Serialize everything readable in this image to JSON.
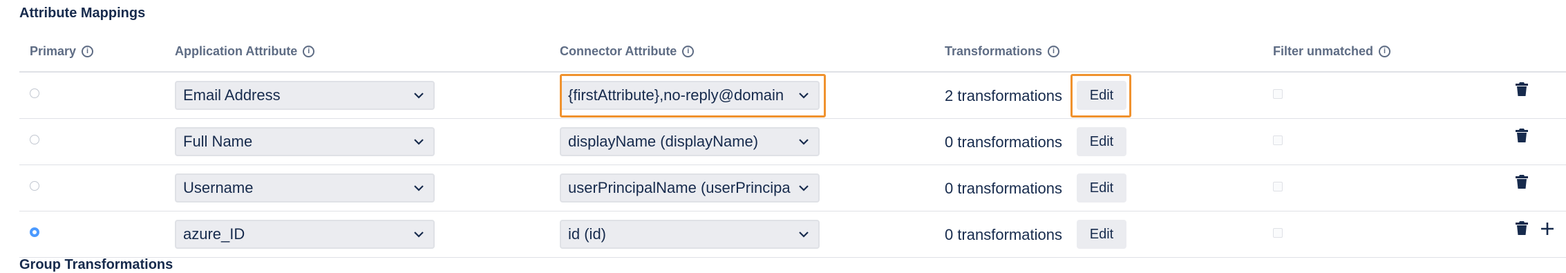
{
  "section": {
    "title": "Attribute Mappings",
    "footer_partial": "Group Transformations"
  },
  "columns": {
    "primary": "Primary",
    "application_attribute": "Application Attribute",
    "connector_attribute": "Connector Attribute",
    "transformations": "Transformations",
    "filter_unmatched": "Filter unmatched"
  },
  "rows": [
    {
      "primary": false,
      "app_attr": "Email Address",
      "conn_attr": "{firstAttribute},no-reply@domain",
      "transformations": "2 transformations",
      "edit": "Edit",
      "filter_unmatched": false
    },
    {
      "primary": false,
      "app_attr": "Full Name",
      "conn_attr": "displayName (displayName)",
      "transformations": "0 transformations",
      "edit": "Edit",
      "filter_unmatched": false
    },
    {
      "primary": false,
      "app_attr": "Username",
      "conn_attr": "userPrincipalName (userPrincipa",
      "transformations": "0 transformations",
      "edit": "Edit",
      "filter_unmatched": false
    },
    {
      "primary": true,
      "app_attr": "azure_ID",
      "conn_attr": "id (id)",
      "transformations": "0 transformations",
      "edit": "Edit",
      "filter_unmatched": false
    }
  ],
  "icons": {
    "info": "info-icon",
    "chevron": "chevron-down-icon",
    "trash": "trash-icon",
    "plus": "plus-icon"
  },
  "colors": {
    "highlight": "#f0922e",
    "radio_selected": "#4c9aff",
    "header_text": "#5e6c84"
  }
}
